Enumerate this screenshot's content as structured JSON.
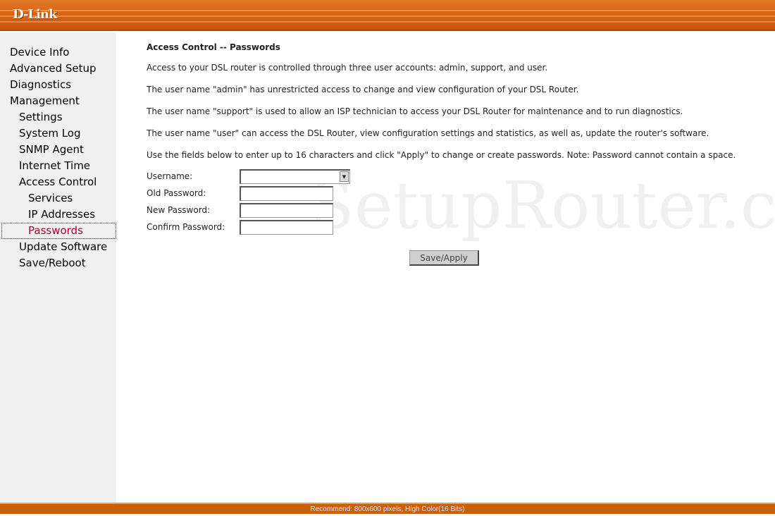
{
  "header": {
    "logo": "D-Link"
  },
  "sidebar": {
    "items": [
      {
        "label": "Device Info",
        "level": 0
      },
      {
        "label": "Advanced Setup",
        "level": 0
      },
      {
        "label": "Diagnostics",
        "level": 0
      },
      {
        "label": "Management",
        "level": 0
      },
      {
        "label": "Settings",
        "level": 1
      },
      {
        "label": "System Log",
        "level": 1
      },
      {
        "label": "SNMP Agent",
        "level": 1
      },
      {
        "label": "Internet Time",
        "level": 1
      },
      {
        "label": "Access Control",
        "level": 1
      },
      {
        "label": "Services",
        "level": 2
      },
      {
        "label": "IP Addresses",
        "level": 2
      },
      {
        "label": "Passwords",
        "level": 2,
        "active": true
      },
      {
        "label": "Update Software",
        "level": 1
      },
      {
        "label": "Save/Reboot",
        "level": 1
      }
    ]
  },
  "main": {
    "title": "Access Control -- Passwords",
    "paragraphs": [
      "Access to your DSL router is controlled through three user accounts: admin, support, and user.",
      "The user name \"admin\" has unrestricted access to change and view configuration of your DSL Router.",
      "The user name \"support\" is used to allow an ISP technician to access your DSL Router for maintenance and to run diagnostics.",
      "The user name \"user\" can access the DSL Router, view configuration settings and statistics, as well as, update the router's software.",
      "Use the fields below to enter up to 16 characters and click \"Apply\" to change or create passwords. Note: Password cannot contain a space."
    ],
    "form": {
      "username_label": "Username:",
      "username_value": "",
      "old_password_label": "Old Password:",
      "new_password_label": "New Password:",
      "confirm_password_label": "Confirm Password:"
    },
    "save_label": "Save/Apply"
  },
  "watermark": "SetupRouter.com",
  "footer": {
    "text": "Recommend: 800x600 pixels, High Color(16 Bits)"
  },
  "colors": {
    "brand": "#d96414",
    "active_nav": "#b00030"
  }
}
